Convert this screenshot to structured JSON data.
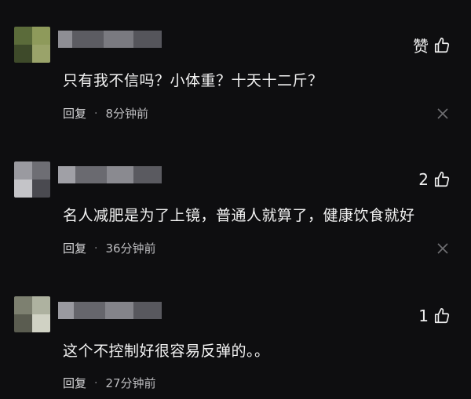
{
  "comments": [
    {
      "text": "只有我不信吗？小体重？十天十二斤？",
      "like_label": "赞",
      "reply_label": "回复",
      "separator": "·",
      "time": "8分钟前",
      "avatar_colors": [
        "#5b6b3a",
        "#7c8a4f",
        "#3e4a2a",
        "#9aa36a"
      ]
    },
    {
      "text": "名人减肥是为了上镜，普通人就算了，健康饮食就好",
      "like_label": "2",
      "reply_label": "回复",
      "separator": "·",
      "time": "36分钟前",
      "avatar_colors": [
        "#9a9aa0",
        "#6e6e74",
        "#c4c4c8",
        "#4a4a50"
      ]
    },
    {
      "text": "这个不控制好很容易反弹的。。",
      "like_label": "1",
      "reply_label": "回复",
      "separator": "·",
      "time": "27分钟前",
      "avatar_colors": [
        "#7d8070",
        "#aeb2a0",
        "#5a5c50",
        "#d0d2c4"
      ]
    }
  ]
}
